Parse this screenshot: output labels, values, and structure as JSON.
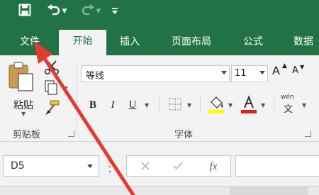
{
  "quick_access": {
    "save_icon": "save-icon",
    "undo_icon": "undo-icon",
    "redo_icon": "redo-icon",
    "customize_icon": "customize-qat-icon"
  },
  "tabs": [
    {
      "label": "文件"
    },
    {
      "label": "开始"
    },
    {
      "label": "插入"
    },
    {
      "label": "页面布局"
    },
    {
      "label": "公式"
    },
    {
      "label": "数据"
    }
  ],
  "clipboard": {
    "paste_label": "粘贴",
    "group_label": "剪贴板"
  },
  "font": {
    "font_name": "等线",
    "font_size": "11",
    "grow_label": "A",
    "shrink_label": "A",
    "bold_label": "B",
    "italic_label": "I",
    "underline_label": "U",
    "phonetic_label": "wén",
    "phonetic_char": "文",
    "group_label": "字体",
    "fill_color": "#ffff00",
    "font_color": "#e0201b"
  },
  "formula_bar": {
    "name_box": "D5",
    "fx_label": "fx"
  },
  "colors": {
    "excel_green": "#217346",
    "annotation_red": "#e53a30"
  }
}
